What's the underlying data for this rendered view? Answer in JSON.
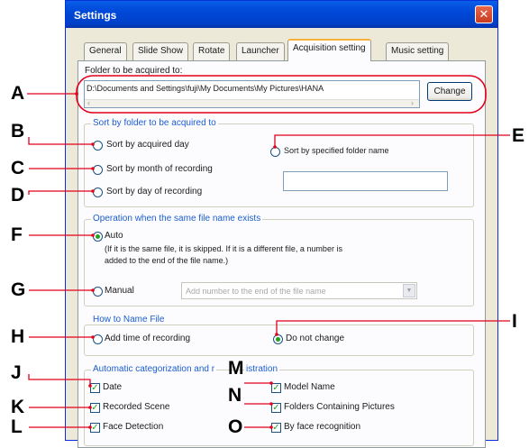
{
  "window": {
    "title": "Settings",
    "close_symbol": "✕"
  },
  "tabs": [
    {
      "label": "General",
      "active": false
    },
    {
      "label": "Slide Show",
      "active": false
    },
    {
      "label": "Rotate",
      "active": false
    },
    {
      "label": "Launcher",
      "active": false
    },
    {
      "label": "Acquisition setting",
      "active": true
    },
    {
      "label": "Music setting",
      "active": false
    }
  ],
  "folder": {
    "label": "Folder to be acquired to:",
    "path": "D:\\Documents and Settings\\fuji\\My Documents\\My Pictures\\HANA",
    "change_label": "Change"
  },
  "sort": {
    "title": "Sort by folder to be acquired to",
    "options": [
      {
        "label": "Sort by acquired day",
        "selected": false
      },
      {
        "label": "Sort by month of recording",
        "selected": false
      },
      {
        "label": "Sort by day of recording",
        "selected": false
      },
      {
        "label": "Sort by specified folder name",
        "selected": false
      }
    ],
    "folder_name_value": ""
  },
  "same_name": {
    "title": "Operation when the same file name exists",
    "auto_label": "Auto",
    "auto_desc_1": "(If it is the same file, it is skipped. If it is a different file, a number is",
    "auto_desc_2": "added to the end of the file name.)",
    "manual_label": "Manual",
    "manual_select": "Add number to the end of the file name"
  },
  "naming": {
    "title": "How to Name File",
    "add_time_label": "Add time of recording",
    "no_change_label": "Do not change",
    "selected": "Do not change"
  },
  "categorize": {
    "title_part1": "Automatic categorization and r",
    "title_part2": "istration",
    "items": [
      {
        "label": "Date",
        "checked": true
      },
      {
        "label": "Recorded Scene",
        "checked": true
      },
      {
        "label": "Face Detection",
        "checked": true
      },
      {
        "label": "Model Name",
        "checked": true
      },
      {
        "label": "Folders Containing Pictures",
        "checked": true
      },
      {
        "label": "By face recognition",
        "checked": true
      }
    ]
  },
  "callouts": [
    "A",
    "B",
    "C",
    "D",
    "E",
    "F",
    "G",
    "H",
    "I",
    "J",
    "K",
    "L",
    "M",
    "N",
    "O"
  ],
  "colors": {
    "titlebar": "#0048d8",
    "section_title": "#1b5dd0",
    "callout_line": "#e2001a",
    "selected_dot": "#21a121"
  }
}
